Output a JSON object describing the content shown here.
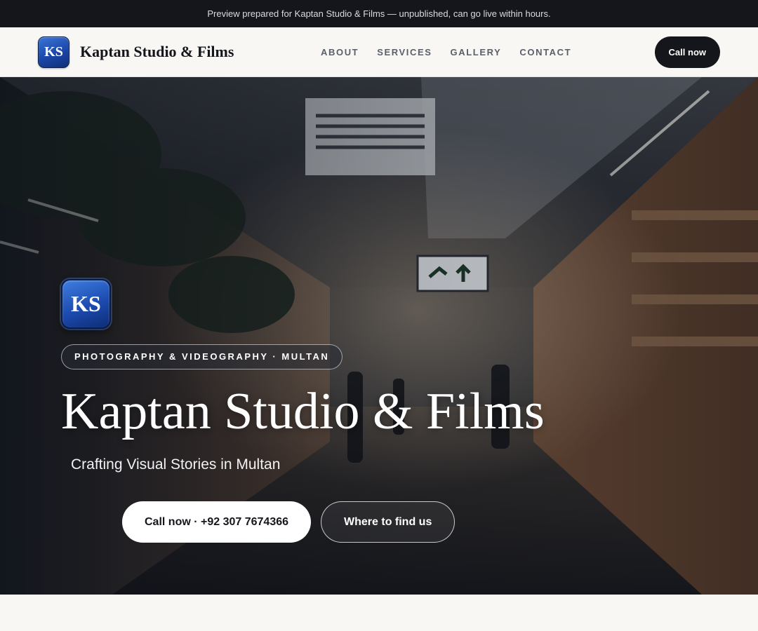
{
  "preview_bar": {
    "text": "Preview prepared for Kaptan Studio & Films — unpublished, can go live within hours."
  },
  "header": {
    "logo_initials": "KS",
    "brand_name": "Kaptan Studio & Films",
    "nav": [
      {
        "label": "ABOUT"
      },
      {
        "label": "SERVICES"
      },
      {
        "label": "GALLERY"
      },
      {
        "label": "CONTACT"
      }
    ],
    "cta_label": "Call now"
  },
  "hero": {
    "logo_initials": "KS",
    "tagline": "PHOTOGRAPHY & VIDEOGRAPHY · MULTAN",
    "title": "Kaptan Studio & Films",
    "subtitle": "Crafting Visual Stories in Multan",
    "primary_button": "Call now · +92 307 7674366",
    "secondary_button": "Where to find us",
    "background_image": "market-alley-photo"
  },
  "colors": {
    "preview_bar_bg": "#15161b",
    "logo_blue": "#1b47a8",
    "cta_dark": "#15161b",
    "page_bg": "#f8f7f4"
  }
}
